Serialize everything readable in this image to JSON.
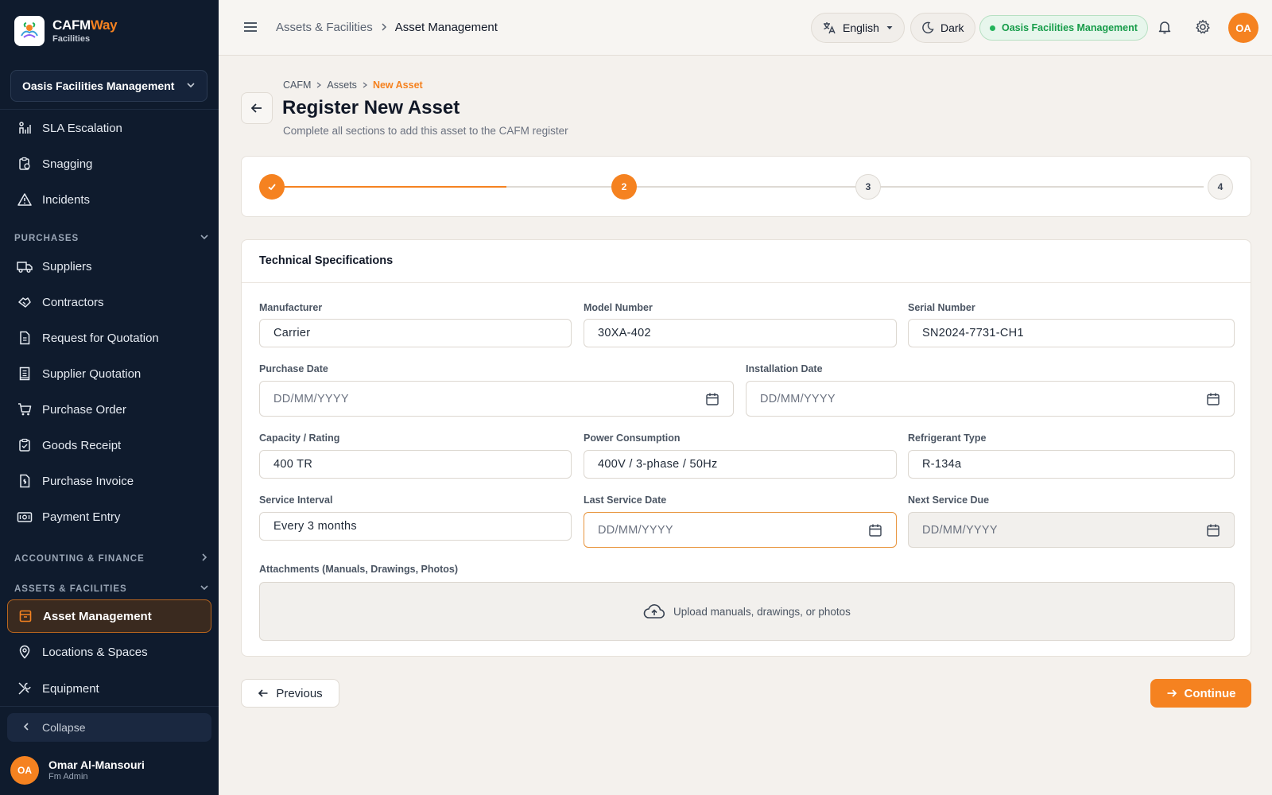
{
  "brand": {
    "name_main": "CAFM",
    "name_accent": "Way",
    "sub": "Facilities"
  },
  "sidebar": {
    "org": "Oasis Facilities Management",
    "items_top": [
      {
        "label": "SLA Escalation",
        "icon": "sla-escalation-icon"
      },
      {
        "label": "Snagging",
        "icon": "clipboard-icon"
      },
      {
        "label": "Incidents",
        "icon": "warning-icon"
      }
    ],
    "section_purchases": "PURCHASES",
    "items_purchases": [
      {
        "label": "Suppliers",
        "icon": "truck-icon"
      },
      {
        "label": "Contractors",
        "icon": "handshake-icon"
      },
      {
        "label": "Request for Quotation",
        "icon": "document-icon"
      },
      {
        "label": "Supplier Quotation",
        "icon": "receipt-icon"
      },
      {
        "label": "Purchase Order",
        "icon": "cart-icon"
      },
      {
        "label": "Goods Receipt",
        "icon": "clipboard-check-icon"
      },
      {
        "label": "Purchase Invoice",
        "icon": "invoice-icon"
      },
      {
        "label": "Payment Entry",
        "icon": "payment-icon"
      }
    ],
    "section_accounting": "ACCOUNTING & FINANCE",
    "section_assets": "ASSETS & FACILITIES",
    "items_assets": [
      {
        "label": "Asset Management",
        "icon": "archive-icon",
        "active": true
      },
      {
        "label": "Locations & Spaces",
        "icon": "location-pin-icon"
      },
      {
        "label": "Equipment",
        "icon": "tools-icon"
      }
    ],
    "collapse": "Collapse",
    "user": {
      "initials": "OA",
      "name": "Omar Al-Mansouri",
      "role": "Fm Admin"
    }
  },
  "topbar": {
    "crumb_parent": "Assets & Facilities",
    "crumb_current": "Asset Management",
    "language": "English",
    "theme": "Dark",
    "org": "Oasis Facilities Management",
    "avatar": "OA"
  },
  "page": {
    "crumb": [
      "CAFM",
      "Assets",
      "New Asset"
    ],
    "title": "Register New Asset",
    "subtitle": "Complete all sections to add this asset to the CAFM register"
  },
  "stepper": {
    "current": 2,
    "steps": [
      "1",
      "2",
      "3",
      "4"
    ]
  },
  "form": {
    "section_title": "Technical Specifications",
    "manufacturer": {
      "label": "Manufacturer",
      "value": "Carrier"
    },
    "model": {
      "label": "Model Number",
      "value": "30XA-402"
    },
    "serial": {
      "label": "Serial Number",
      "value": "SN2024-7731-CH1"
    },
    "purchase_date": {
      "label": "Purchase Date",
      "placeholder": "DD/MM/YYYY"
    },
    "install_date": {
      "label": "Installation Date",
      "placeholder": "DD/MM/YYYY"
    },
    "capacity": {
      "label": "Capacity / Rating",
      "value": "400 TR"
    },
    "power": {
      "label": "Power Consumption",
      "value": "400V / 3-phase / 50Hz"
    },
    "refrigerant": {
      "label": "Refrigerant Type",
      "value": "R-134a"
    },
    "service_interval": {
      "label": "Service Interval",
      "value": "Every 3 months"
    },
    "last_service": {
      "label": "Last Service Date",
      "placeholder": "DD/MM/YYYY"
    },
    "next_service": {
      "label": "Next Service Due",
      "placeholder": "DD/MM/YYYY"
    },
    "attachments": {
      "label": "Attachments (Manuals, Drawings, Photos)",
      "hint": "Upload manuals, drawings, or photos"
    }
  },
  "actions": {
    "previous": "Previous",
    "continue": "Continue"
  },
  "colors": {
    "accent": "#f58220",
    "sidebar_bg": "#0f1b2d",
    "success": "#169c49"
  }
}
